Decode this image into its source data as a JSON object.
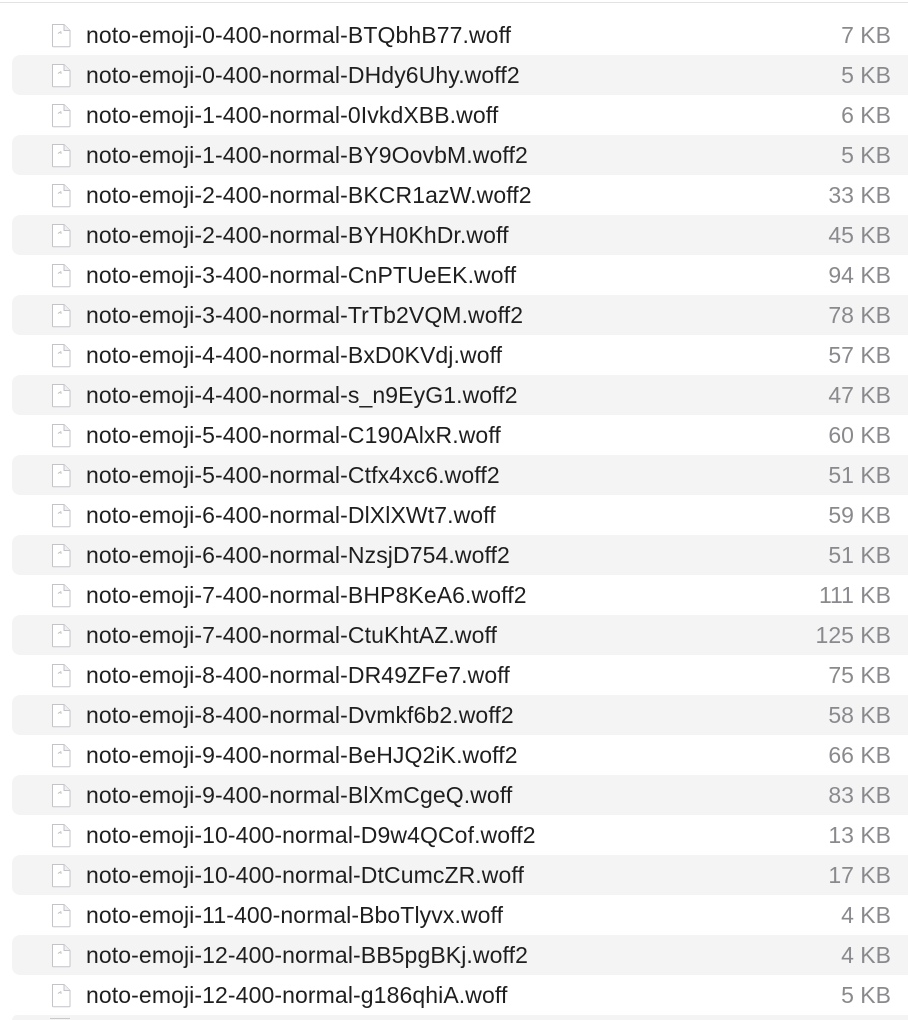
{
  "files": [
    {
      "name": "noto-emoji-0-400-normal-BTQbhB77.woff",
      "size": "7 KB",
      "icon": "document-icon"
    },
    {
      "name": "noto-emoji-0-400-normal-DHdy6Uhy.woff2",
      "size": "5 KB",
      "icon": "document-icon"
    },
    {
      "name": "noto-emoji-1-400-normal-0IvkdXBB.woff",
      "size": "6 KB",
      "icon": "document-icon"
    },
    {
      "name": "noto-emoji-1-400-normal-BY9OovbM.woff2",
      "size": "5 KB",
      "icon": "document-icon"
    },
    {
      "name": "noto-emoji-2-400-normal-BKCR1azW.woff2",
      "size": "33 KB",
      "icon": "document-icon"
    },
    {
      "name": "noto-emoji-2-400-normal-BYH0KhDr.woff",
      "size": "45 KB",
      "icon": "document-icon"
    },
    {
      "name": "noto-emoji-3-400-normal-CnPTUeEK.woff",
      "size": "94 KB",
      "icon": "document-icon"
    },
    {
      "name": "noto-emoji-3-400-normal-TrTb2VQM.woff2",
      "size": "78 KB",
      "icon": "document-icon"
    },
    {
      "name": "noto-emoji-4-400-normal-BxD0KVdj.woff",
      "size": "57 KB",
      "icon": "document-icon"
    },
    {
      "name": "noto-emoji-4-400-normal-s_n9EyG1.woff2",
      "size": "47 KB",
      "icon": "document-icon"
    },
    {
      "name": "noto-emoji-5-400-normal-C190AlxR.woff",
      "size": "60 KB",
      "icon": "document-icon"
    },
    {
      "name": "noto-emoji-5-400-normal-Ctfx4xc6.woff2",
      "size": "51 KB",
      "icon": "document-icon"
    },
    {
      "name": "noto-emoji-6-400-normal-DlXlXWt7.woff",
      "size": "59 KB",
      "icon": "document-icon"
    },
    {
      "name": "noto-emoji-6-400-normal-NzsjD754.woff2",
      "size": "51 KB",
      "icon": "document-icon"
    },
    {
      "name": "noto-emoji-7-400-normal-BHP8KeA6.woff2",
      "size": "111 KB",
      "icon": "document-icon"
    },
    {
      "name": "noto-emoji-7-400-normal-CtuKhtAZ.woff",
      "size": "125 KB",
      "icon": "document-icon"
    },
    {
      "name": "noto-emoji-8-400-normal-DR49ZFe7.woff",
      "size": "75 KB",
      "icon": "document-icon"
    },
    {
      "name": "noto-emoji-8-400-normal-Dvmkf6b2.woff2",
      "size": "58 KB",
      "icon": "document-icon"
    },
    {
      "name": "noto-emoji-9-400-normal-BeHJQ2iK.woff2",
      "size": "66 KB",
      "icon": "document-icon"
    },
    {
      "name": "noto-emoji-9-400-normal-BlXmCgeQ.woff",
      "size": "83 KB",
      "icon": "document-icon"
    },
    {
      "name": "noto-emoji-10-400-normal-D9w4QCof.woff2",
      "size": "13 KB",
      "icon": "document-icon"
    },
    {
      "name": "noto-emoji-10-400-normal-DtCumcZR.woff",
      "size": "17 KB",
      "icon": "document-icon"
    },
    {
      "name": "noto-emoji-11-400-normal-BboTlyvx.woff",
      "size": "4 KB",
      "icon": "document-icon"
    },
    {
      "name": "noto-emoji-12-400-normal-BB5pgBKj.woff2",
      "size": "4 KB",
      "icon": "document-icon"
    },
    {
      "name": "noto-emoji-12-400-normal-g186qhiA.woff",
      "size": "5 KB",
      "icon": "document-icon"
    }
  ],
  "colors": {
    "row_alt_background": "#f4f4f5",
    "filename_text": "#1e1e1e",
    "size_text": "#8a8a8e"
  }
}
